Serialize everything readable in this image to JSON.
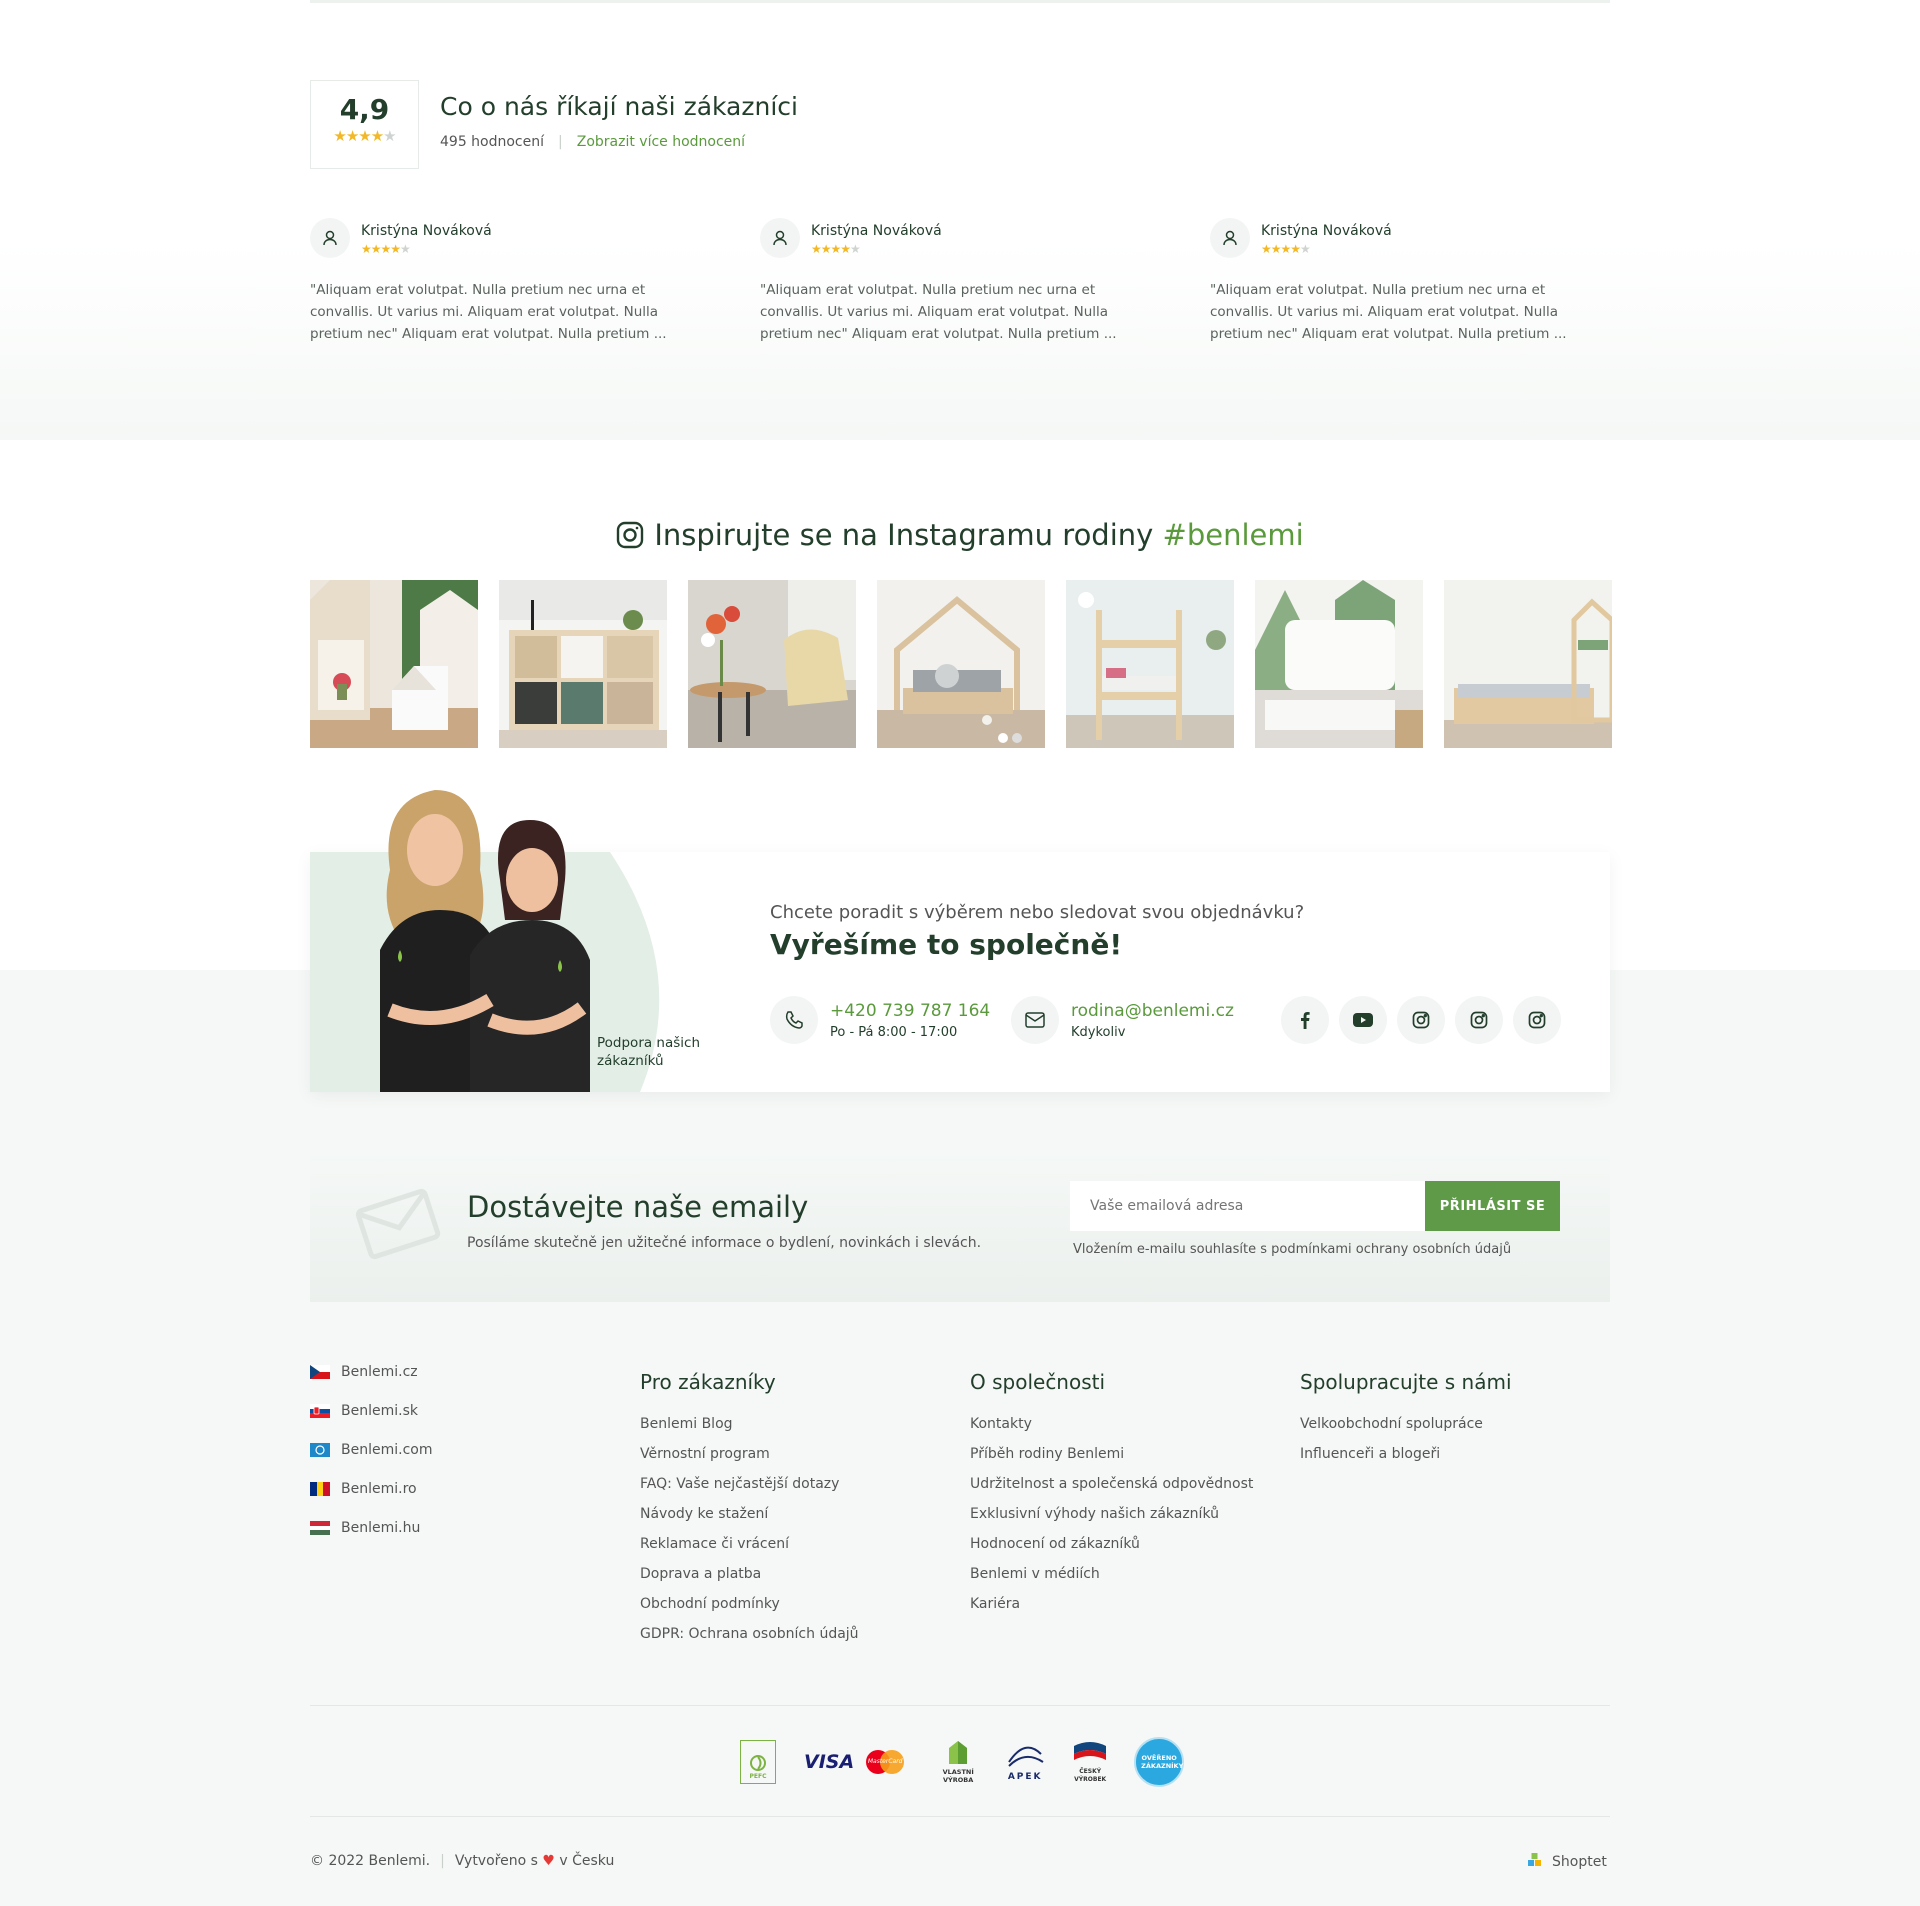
{
  "reviews": {
    "score": "4,9",
    "title": "Co o nás říkají naši zákazníci",
    "count": "495 hodnocení",
    "more_link": "Zobrazit více hodnocení",
    "items": [
      {
        "name": "Kristýna Nováková",
        "text": "\"Aliquam erat volutpat. Nulla pretium nec urna et convallis. Ut varius mi. Aliquam erat volutpat. Nulla pretium nec\" Aliquam erat volutpat. Nulla pretium ..."
      },
      {
        "name": "Kristýna Nováková",
        "text": "\"Aliquam erat volutpat. Nulla pretium nec urna et convallis. Ut varius mi. Aliquam erat volutpat. Nulla pretium nec\" Aliquam erat volutpat. Nulla pretium ..."
      },
      {
        "name": "Kristýna Nováková",
        "text": "\"Aliquam erat volutpat. Nulla pretium nec urna et convallis. Ut varius mi. Aliquam erat volutpat. Nulla pretium nec\" Aliquam erat volutpat. Nulla pretium ..."
      }
    ]
  },
  "instagram": {
    "title": "Inspirujte se na Instagramu rodiny ",
    "hashtag": "#benlemi",
    "icon": "instagram-icon"
  },
  "support": {
    "label_line1": "Podpora našich",
    "label_line2": "zákazníků",
    "question": "Chcete poradit s výběrem nebo sledovat svou objednávku?",
    "headline": "Vyřešíme to společně!",
    "phone": "+420 739 787 164",
    "phone_hours": "Po - Pá 8:00 - 17:00",
    "email": "rodina@benlemi.cz",
    "email_hours": "Kdykoliv",
    "socials": [
      "facebook-icon",
      "youtube-icon",
      "instagram-icon",
      "instagram-icon",
      "instagram-icon"
    ]
  },
  "newsletter": {
    "title": "Dostávejte naše emaily",
    "subtitle": "Posíláme skutečně jen užitečné informace o bydlení, novinkách i slevách.",
    "placeholder": "Vaše emailová adresa",
    "button": "PŘIHLÁSIT SE",
    "note": "Vložením e-mailu souhlasíte s podmínkami ochrany osobních údajů"
  },
  "footer": {
    "sites": [
      "Benlemi.cz",
      "Benlemi.sk",
      "Benlemi.com",
      "Benlemi.ro",
      "Benlemi.hu"
    ],
    "col1": {
      "title": "Pro zákazníky",
      "links": [
        "Benlemi Blog",
        "Věrnostní program",
        "FAQ: Vaše nejčastější dotazy",
        "Návody ke stažení",
        "Reklamace či vrácení",
        "Doprava a platba",
        "Obchodní podmínky",
        "GDPR: Ochrana osobních údajů"
      ]
    },
    "col2": {
      "title": "O společnosti",
      "links": [
        "Kontakty",
        "Příběh rodiny Benlemi",
        "Udržitelnost a společenská odpovědnost",
        "Exklusivní výhody našich zákazníků",
        "Hodnocení od zákazníků",
        "Benlemi v médiích",
        "Kariéra"
      ]
    },
    "col3": {
      "title": "Spolupracujte s námi",
      "links": [
        "Velkoobchodní spolupráce",
        "Influenceři a blogeři"
      ]
    },
    "badges": {
      "pefc": "PEFC",
      "visa": "VISA",
      "mastercard": "MasterCard",
      "vlastni": "VLASTNÍ VÝROBA",
      "apek": "APEK",
      "cesky": "ČESKÝ VÝROBEK",
      "heureka": "OVĚŘENO ZÁKAZNÍKY"
    },
    "copyright": "© 2022 Benlemi.",
    "made_with_prefix": "Vytvořeno s",
    "made_with_suffix": "v Česku",
    "shoptet": "Shoptet"
  },
  "colors": {
    "accent": "#5a9a3c",
    "dark_green": "#233f2c",
    "button": "#5e9a48",
    "star": "#f2b827"
  }
}
